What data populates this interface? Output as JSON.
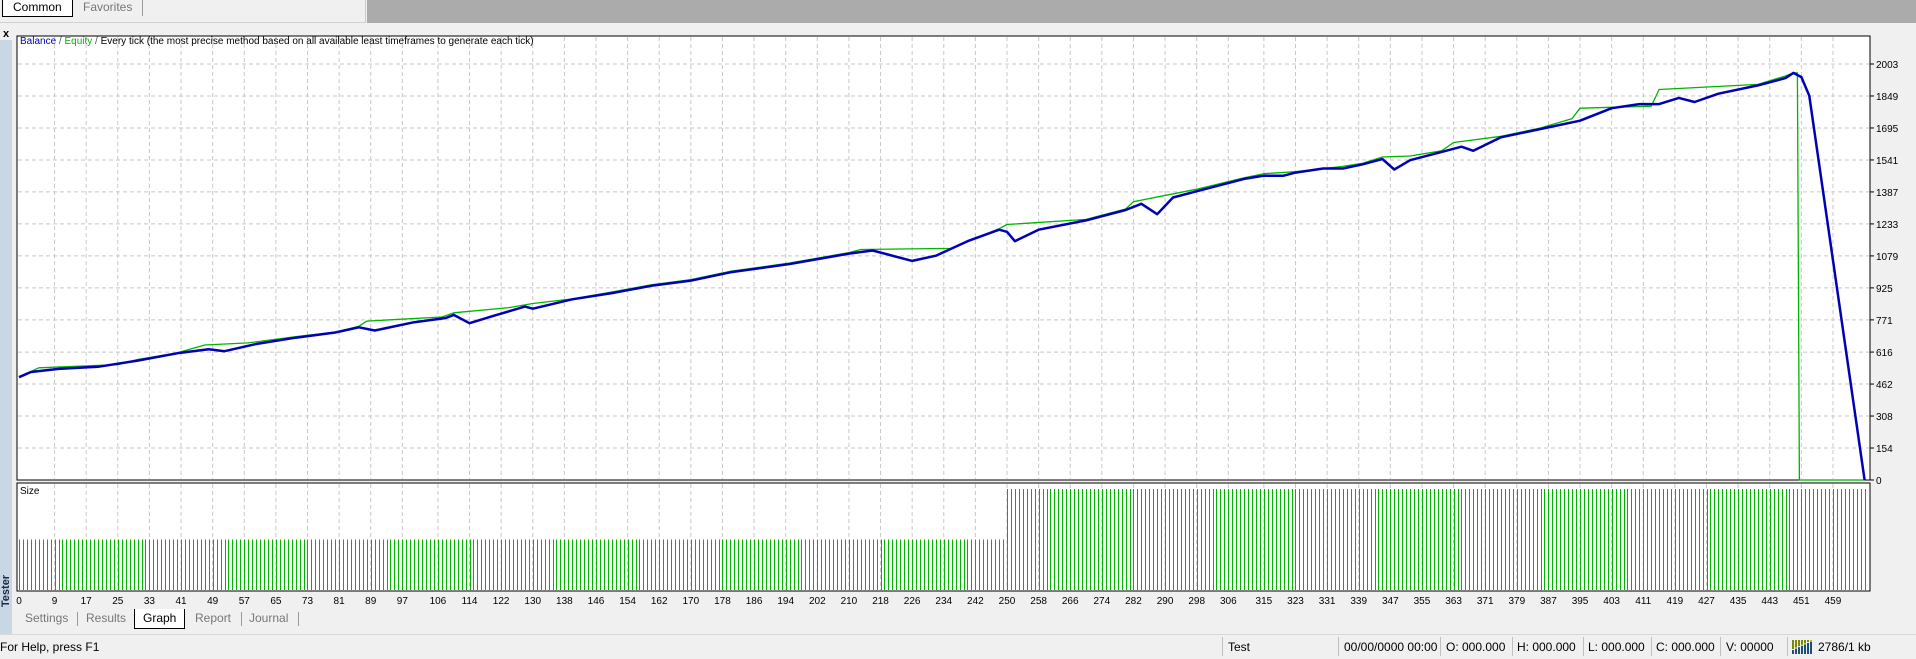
{
  "top_tabs": [
    {
      "label": "Common",
      "selected": true
    },
    {
      "label": "Favorites",
      "selected": false
    }
  ],
  "close_label": "x",
  "panel_side_label": "Tester",
  "chart_header": {
    "balance": "Balance",
    "sep1": " / ",
    "equity": "Equity",
    "sep2": " / ",
    "model": "Every tick (the most precise method based on all available least timeframes to generate each tick)"
  },
  "size_label": "Size",
  "colors": {
    "balance": "#0000b4",
    "equity": "#00b400",
    "size_bars": "#00b400",
    "grid": "#c8c8c8"
  },
  "chart_data": {
    "type": "line",
    "ylim": [
      0,
      2003
    ],
    "xlim": [
      0,
      467
    ],
    "grid": true,
    "y_ticks": [
      "2003",
      "1849",
      "1695",
      "1541",
      "1387",
      "1233",
      "1079",
      "925",
      "771",
      "616",
      "462",
      "308",
      "154",
      "0"
    ],
    "x_ticks": [
      "0",
      "9",
      "17",
      "25",
      "33",
      "41",
      "49",
      "57",
      "65",
      "73",
      "81",
      "89",
      "97",
      "106",
      "114",
      "122",
      "130",
      "138",
      "146",
      "154",
      "162",
      "170",
      "178",
      "186",
      "194",
      "202",
      "210",
      "218",
      "226",
      "234",
      "242",
      "250",
      "258",
      "266",
      "274",
      "282",
      "290",
      "298",
      "306",
      "315",
      "323",
      "331",
      "339",
      "347",
      "355",
      "363",
      "371",
      "379",
      "387",
      "395",
      "403",
      "411",
      "419",
      "427",
      "435",
      "443",
      "451",
      "459"
    ],
    "series": [
      {
        "name": "Balance",
        "color": "#0000b4",
        "points": [
          [
            0,
            495
          ],
          [
            3,
            520
          ],
          [
            10,
            535
          ],
          [
            20,
            545
          ],
          [
            30,
            575
          ],
          [
            40,
            610
          ],
          [
            48,
            630
          ],
          [
            52,
            620
          ],
          [
            60,
            655
          ],
          [
            70,
            685
          ],
          [
            80,
            710
          ],
          [
            86,
            735
          ],
          [
            90,
            720
          ],
          [
            100,
            760
          ],
          [
            108,
            780
          ],
          [
            110,
            795
          ],
          [
            114,
            755
          ],
          [
            120,
            790
          ],
          [
            128,
            835
          ],
          [
            130,
            825
          ],
          [
            140,
            870
          ],
          [
            150,
            900
          ],
          [
            160,
            935
          ],
          [
            170,
            960
          ],
          [
            180,
            1000
          ],
          [
            195,
            1040
          ],
          [
            210,
            1090
          ],
          [
            216,
            1105
          ],
          [
            226,
            1055
          ],
          [
            232,
            1080
          ],
          [
            240,
            1150
          ],
          [
            248,
            1205
          ],
          [
            250,
            1195
          ],
          [
            252,
            1150
          ],
          [
            258,
            1205
          ],
          [
            270,
            1250
          ],
          [
            280,
            1300
          ],
          [
            284,
            1330
          ],
          [
            288,
            1280
          ],
          [
            292,
            1360
          ],
          [
            300,
            1400
          ],
          [
            310,
            1450
          ],
          [
            315,
            1465
          ],
          [
            320,
            1465
          ],
          [
            323,
            1480
          ],
          [
            330,
            1500
          ],
          [
            335,
            1500
          ],
          [
            340,
            1520
          ],
          [
            345,
            1545
          ],
          [
            348,
            1495
          ],
          [
            352,
            1540
          ],
          [
            360,
            1580
          ],
          [
            365,
            1605
          ],
          [
            368,
            1585
          ],
          [
            375,
            1650
          ],
          [
            385,
            1690
          ],
          [
            395,
            1730
          ],
          [
            403,
            1790
          ],
          [
            410,
            1810
          ],
          [
            415,
            1810
          ],
          [
            420,
            1840
          ],
          [
            424,
            1820
          ],
          [
            430,
            1860
          ],
          [
            440,
            1900
          ],
          [
            447,
            1935
          ],
          [
            449,
            1960
          ],
          [
            451,
            1940
          ],
          [
            453,
            1850
          ],
          [
            467,
            0
          ]
        ]
      },
      {
        "name": "Equity",
        "color": "#00b400",
        "points": [
          [
            0,
            495
          ],
          [
            5,
            540
          ],
          [
            25,
            555
          ],
          [
            30,
            580
          ],
          [
            40,
            612
          ],
          [
            47,
            650
          ],
          [
            58,
            660
          ],
          [
            70,
            690
          ],
          [
            80,
            712
          ],
          [
            86,
            740
          ],
          [
            88,
            765
          ],
          [
            107,
            785
          ],
          [
            110,
            805
          ],
          [
            124,
            830
          ],
          [
            130,
            850
          ],
          [
            140,
            872
          ],
          [
            150,
            905
          ],
          [
            160,
            940
          ],
          [
            170,
            965
          ],
          [
            180,
            1005
          ],
          [
            195,
            1045
          ],
          [
            210,
            1095
          ],
          [
            213,
            1110
          ],
          [
            236,
            1115
          ],
          [
            248,
            1210
          ],
          [
            250,
            1230
          ],
          [
            270,
            1255
          ],
          [
            280,
            1305
          ],
          [
            282,
            1340
          ],
          [
            298,
            1400
          ],
          [
            310,
            1455
          ],
          [
            315,
            1475
          ],
          [
            323,
            1485
          ],
          [
            335,
            1510
          ],
          [
            340,
            1525
          ],
          [
            345,
            1555
          ],
          [
            352,
            1560
          ],
          [
            360,
            1585
          ],
          [
            363,
            1625
          ],
          [
            375,
            1655
          ],
          [
            385,
            1695
          ],
          [
            393,
            1740
          ],
          [
            395,
            1790
          ],
          [
            413,
            1800
          ],
          [
            415,
            1880
          ],
          [
            440,
            1905
          ],
          [
            447,
            1945
          ],
          [
            449,
            1960
          ],
          [
            450,
            1960
          ],
          [
            450.5,
            0
          ],
          [
            467,
            0
          ]
        ]
      }
    ],
    "size": {
      "label": "Size",
      "ylim": [
        0,
        2.1
      ],
      "segments": [
        {
          "from": 0,
          "to": 249,
          "level": 1
        },
        {
          "from": 250,
          "to": 467,
          "level": 2
        }
      ]
    }
  },
  "bottom_tabs": [
    {
      "label": "Settings"
    },
    {
      "label": "Results"
    },
    {
      "label": "Graph",
      "selected": true
    },
    {
      "label": "Report"
    },
    {
      "label": "Journal"
    }
  ],
  "status_bar": {
    "help": "For Help, press F1",
    "profile": "Test",
    "datetime": "00/00/0000 00:00",
    "open": "O: 000.000",
    "high": "H: 000.000",
    "low": "L: 000.000",
    "close": "C: 000.000",
    "volume": "V: 00000",
    "traffic": "2786/1 kb"
  }
}
